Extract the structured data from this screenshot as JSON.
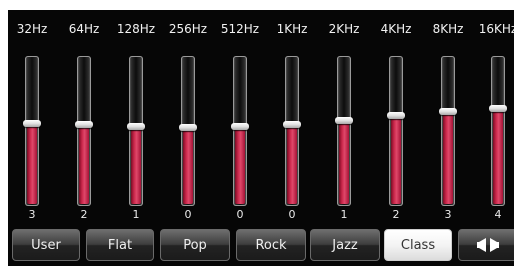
{
  "equalizer": {
    "bands": [
      {
        "freq": "32Hz",
        "value": "3",
        "level": 0.55
      },
      {
        "freq": "64Hz",
        "value": "2",
        "level": 0.54
      },
      {
        "freq": "128Hz",
        "value": "1",
        "level": 0.53
      },
      {
        "freq": "256Hz",
        "value": "0",
        "level": 0.52
      },
      {
        "freq": "512Hz",
        "value": "0",
        "level": 0.53
      },
      {
        "freq": "1KHz",
        "value": "0",
        "level": 0.54
      },
      {
        "freq": "2KHz",
        "value": "1",
        "level": 0.57
      },
      {
        "freq": "4KHz",
        "value": "2",
        "level": 0.6
      },
      {
        "freq": "8KHz",
        "value": "3",
        "level": 0.63
      },
      {
        "freq": "16KHz",
        "value": "4",
        "level": 0.65
      }
    ],
    "fill_color": "#d12b4f"
  },
  "presets": {
    "items": [
      {
        "label": "User"
      },
      {
        "label": "Flat"
      },
      {
        "label": "Pop"
      },
      {
        "label": "Rock"
      },
      {
        "label": "Jazz"
      },
      {
        "label": "Class"
      }
    ],
    "selected": "Class",
    "extra_button_icon": "speaker-balance-icon"
  }
}
